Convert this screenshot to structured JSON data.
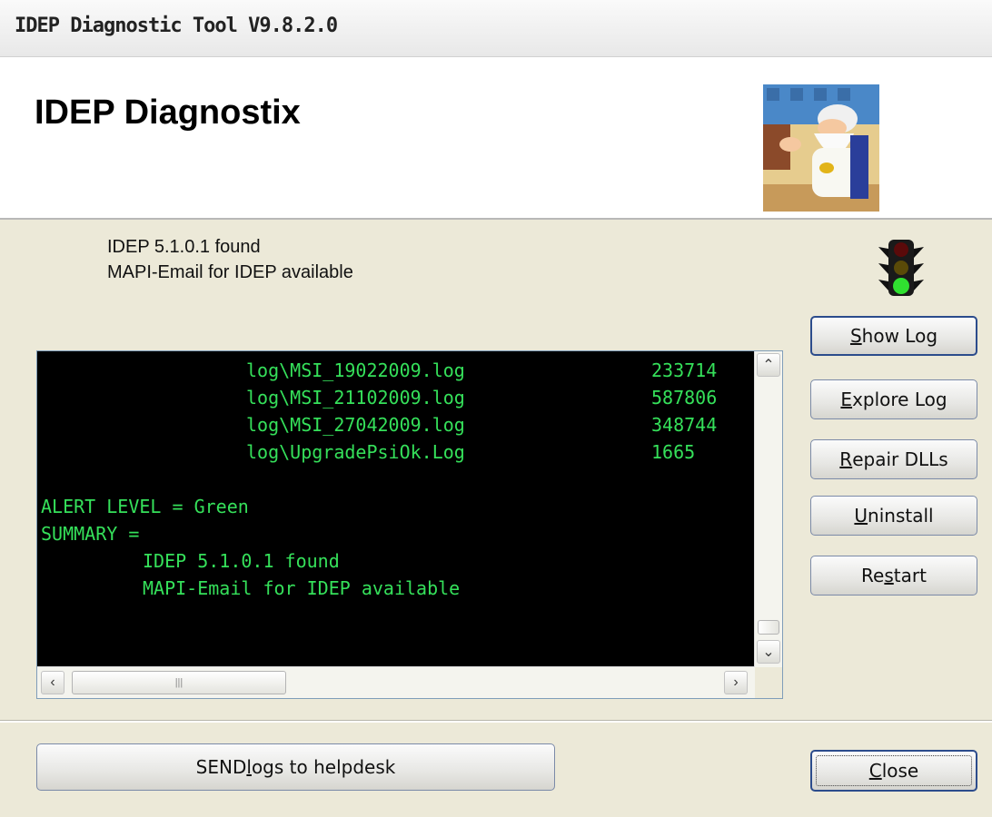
{
  "window": {
    "title": "IDEP Diagnostic Tool V9.8.2.0"
  },
  "header": {
    "app_title": "IDEP Diagnostix"
  },
  "status": {
    "line1": "IDEP 5.1.0.1 found",
    "line2": "MAPI-Email for IDEP available",
    "traffic_light": "green",
    "traffic_light_icon": "traffic-light-icon"
  },
  "buttons": {
    "show_log": {
      "pre": "",
      "key": "S",
      "post": "how Log"
    },
    "explore_log": {
      "pre": "",
      "key": "E",
      "post": "xplore Log"
    },
    "repair_dlls": {
      "pre": "",
      "key": "R",
      "post": "epair DLLs"
    },
    "uninstall": {
      "pre": "",
      "key": "U",
      "post": "ninstall"
    },
    "restart": {
      "pre": "Re",
      "key": "s",
      "post": "tart"
    },
    "send_logs": {
      "pre": "SEND ",
      "key": "l",
      "post": "ogs to helpdesk"
    },
    "close": {
      "pre": "",
      "key": "C",
      "post": "lose"
    }
  },
  "console": {
    "files": [
      {
        "name": "log\\MSI_19022009.log",
        "size": "233714"
      },
      {
        "name": "log\\MSI_21102009.log",
        "size": "587806"
      },
      {
        "name": "log\\MSI_27042009.log",
        "size": "348744"
      },
      {
        "name": "log\\UpgradePsiOk.Log",
        "size": "1665"
      }
    ],
    "alert_line": "ALERT LEVEL = Green",
    "summary_label": "SUMMARY =",
    "summary_items": [
      "IDEP 5.1.0.1 found",
      "MAPI-Email for IDEP available"
    ]
  },
  "colors": {
    "console_text": "#35e05a",
    "console_bg": "#000000",
    "window_bg": "#ece9d8"
  }
}
